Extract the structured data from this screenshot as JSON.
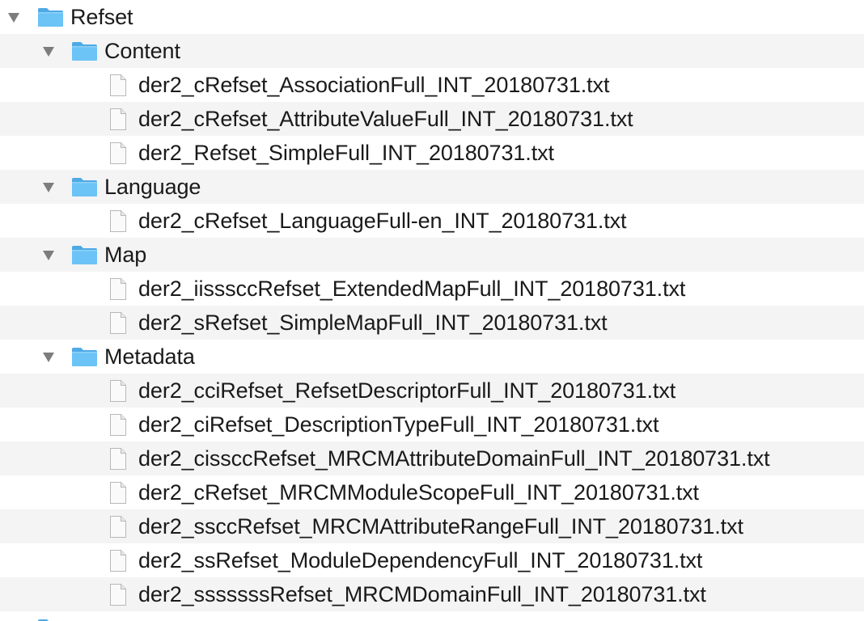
{
  "tree": {
    "root": {
      "label": "Refset",
      "expanded": true
    },
    "folders": [
      {
        "label": "Content",
        "files": [
          "der2_cRefset_AssociationFull_INT_20180731.txt",
          "der2_cRefset_AttributeValueFull_INT_20180731.txt",
          "der2_Refset_SimpleFull_INT_20180731.txt"
        ]
      },
      {
        "label": "Language",
        "files": [
          "der2_cRefset_LanguageFull-en_INT_20180731.txt"
        ]
      },
      {
        "label": "Map",
        "files": [
          "der2_iisssccRefset_ExtendedMapFull_INT_20180731.txt",
          "der2_sRefset_SimpleMapFull_INT_20180731.txt"
        ]
      },
      {
        "label": "Metadata",
        "files": [
          "der2_cciRefset_RefsetDescriptorFull_INT_20180731.txt",
          "der2_ciRefset_DescriptionTypeFull_INT_20180731.txt",
          "der2_cissccRefset_MRCMAttributeDomainFull_INT_20180731.txt",
          "der2_cRefset_MRCMModuleScopeFull_INT_20180731.txt",
          "der2_ssccRefset_MRCMAttributeRangeFull_INT_20180731.txt",
          "der2_ssRefset_ModuleDependencyFull_INT_20180731.txt",
          "der2_sssssssRefset_MRCMDomainFull_INT_20180731.txt"
        ]
      }
    ]
  },
  "icons": {
    "folder": "folder-icon",
    "file": "document-icon",
    "disclosure": "disclosure-triangle-down-icon"
  },
  "colors": {
    "folder_body": "#6cc3f5",
    "folder_tab": "#4fa9e6",
    "disclosure": "#7d7d7d",
    "alt_row": "#f4f4f5"
  }
}
